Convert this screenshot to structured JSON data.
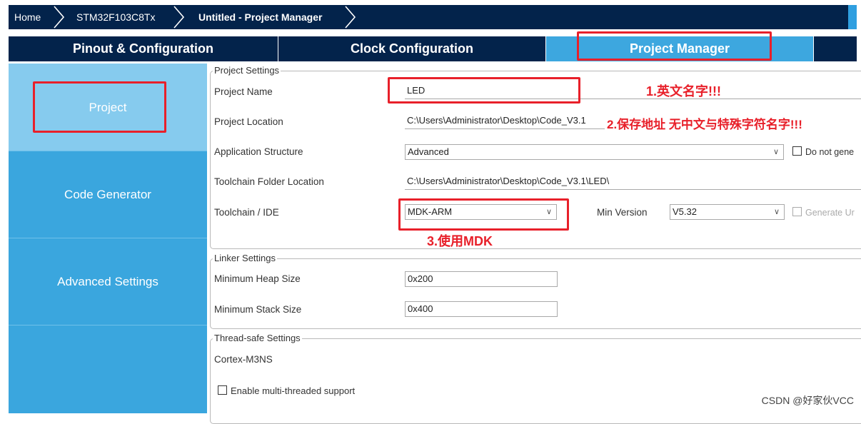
{
  "breadcrumb": {
    "home": "Home",
    "chip": "STM32F103C8Tx",
    "page": "Untitled - Project Manager"
  },
  "tabs": [
    {
      "label": "Pinout & Configuration"
    },
    {
      "label": "Clock Configuration"
    },
    {
      "label": "Project Manager"
    }
  ],
  "sidebar": {
    "items": [
      {
        "label": "Project"
      },
      {
        "label": "Code Generator"
      },
      {
        "label": "Advanced Settings"
      }
    ]
  },
  "project_settings": {
    "title": "Project Settings",
    "name_label": "Project Name",
    "name_value": "LED",
    "location_label": "Project Location",
    "location_value": "C:\\Users\\Administrator\\Desktop\\Code_V3.1",
    "structure_label": "Application Structure",
    "structure_value": "Advanced",
    "do_not_generate_label": "Do not gene",
    "toolchain_folder_label": "Toolchain Folder Location",
    "toolchain_folder_value": "C:\\Users\\Administrator\\Desktop\\Code_V3.1\\LED\\",
    "toolchain_label": "Toolchain / IDE",
    "toolchain_value": "MDK-ARM",
    "min_version_label": "Min Version",
    "min_version_value": "V5.32",
    "generate_label": "Generate Ur"
  },
  "linker_settings": {
    "title": "Linker Settings",
    "heap_label": "Minimum Heap Size",
    "heap_value": "0x200",
    "stack_label": "Minimum Stack Size",
    "stack_value": "0x400"
  },
  "thread_settings": {
    "title": "Thread-safe Settings",
    "core": "Cortex-M3NS",
    "multithread_label": "Enable multi-threaded support"
  },
  "annotations": {
    "a1": "1.英文名字!!!",
    "a2": "2.保存地址  无中文与特殊字符名字!!!",
    "a3": "3.使用MDK"
  },
  "watermark": "CSDN @好家伙VCC",
  "colors": {
    "header_bg": "#03234b",
    "accent": "#3aa6de",
    "annotation_red": "#e8202a"
  }
}
